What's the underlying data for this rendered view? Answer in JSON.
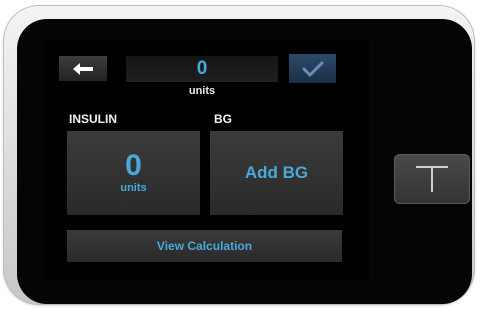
{
  "header": {
    "units_value": "0",
    "units_caption": "units"
  },
  "icons": {
    "back": "left-arrow-icon",
    "confirm": "checkmark-icon",
    "device_button": "t-button-icon"
  },
  "sections": {
    "insulin_label": "INSULIN",
    "bg_label": "BG"
  },
  "insulin": {
    "value": "0",
    "units": "units"
  },
  "bg": {
    "action_label": "Add BG"
  },
  "footer": {
    "view_calculation_label": "View Calculation"
  },
  "colors": {
    "accent": "#4aa8d8",
    "confirm_bg": "#2d4a6a",
    "screen_bg": "#000000"
  }
}
